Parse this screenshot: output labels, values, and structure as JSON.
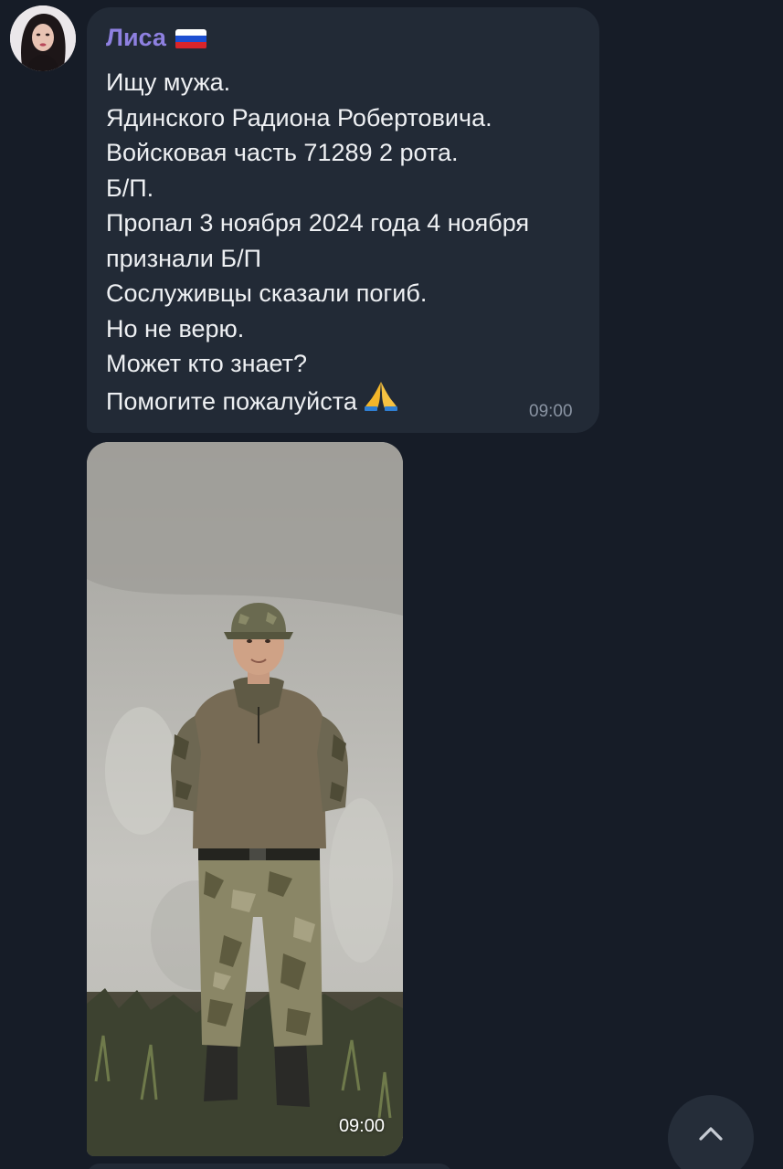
{
  "message": {
    "sender": "Лиса",
    "lines": [
      "Ищу мужа.",
      "Ядинского Радиона Робертовича.",
      "Войсковая часть 71289 2 рота.",
      "Б/П.",
      "Пропал 3 ноября 2024 года 4 ноября",
      "признали Б/П",
      "Сослуживцы сказали погиб.",
      "Но не верю.",
      "Может кто знает?",
      "Помогите пожалуйста"
    ],
    "time": "09:00"
  },
  "photo_message": {
    "time": "09:00"
  },
  "colors": {
    "background": "#161c27",
    "bubble": "#222a36",
    "sender_name": "#8e80e0",
    "text": "#eef0f3",
    "timestamp": "#8a94a3"
  },
  "icons": {
    "flag": "russia-flag-icon",
    "emoji": "folded-hands-icon",
    "scroll": "chevron-up-icon"
  }
}
